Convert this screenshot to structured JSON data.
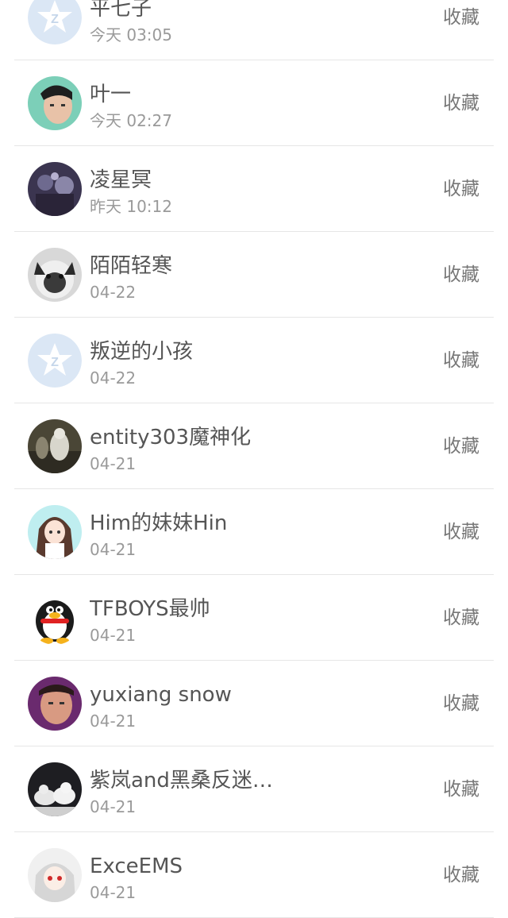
{
  "rows": [
    {
      "name": "平七子",
      "time": "今天 03:05",
      "action": "收藏",
      "avatar": "default-star-avatar"
    },
    {
      "name": "叶一",
      "time": "今天 02:27",
      "action": "收藏",
      "avatar": "photo-avatar"
    },
    {
      "name": "凌星冥",
      "time": "昨天 10:12",
      "action": "收藏",
      "avatar": "photo-avatar"
    },
    {
      "name": "陌陌轻寒",
      "time": "04-22",
      "action": "收藏",
      "avatar": "cat-avatar"
    },
    {
      "name": "叛逆的小孩",
      "time": "04-22",
      "action": "收藏",
      "avatar": "default-star-avatar"
    },
    {
      "name": "entity303魔神化",
      "time": "04-21",
      "action": "收藏",
      "avatar": "photo-avatar"
    },
    {
      "name": "Him的妹妹Hin",
      "time": "04-21",
      "action": "收藏",
      "avatar": "anime-girl-avatar"
    },
    {
      "name": "TFBOYS最帅",
      "time": "04-21",
      "action": "收藏",
      "avatar": "penguin-avatar"
    },
    {
      "name": "yuxiang snow",
      "time": "04-21",
      "action": "收藏",
      "avatar": "photo-avatar"
    },
    {
      "name": "紫岚and黑桑反迷…",
      "time": "04-21",
      "action": "收藏",
      "avatar": "wolves-avatar"
    },
    {
      "name": "ExceEMS",
      "time": "04-21",
      "action": "收藏",
      "avatar": "anime-girl-avatar"
    }
  ]
}
